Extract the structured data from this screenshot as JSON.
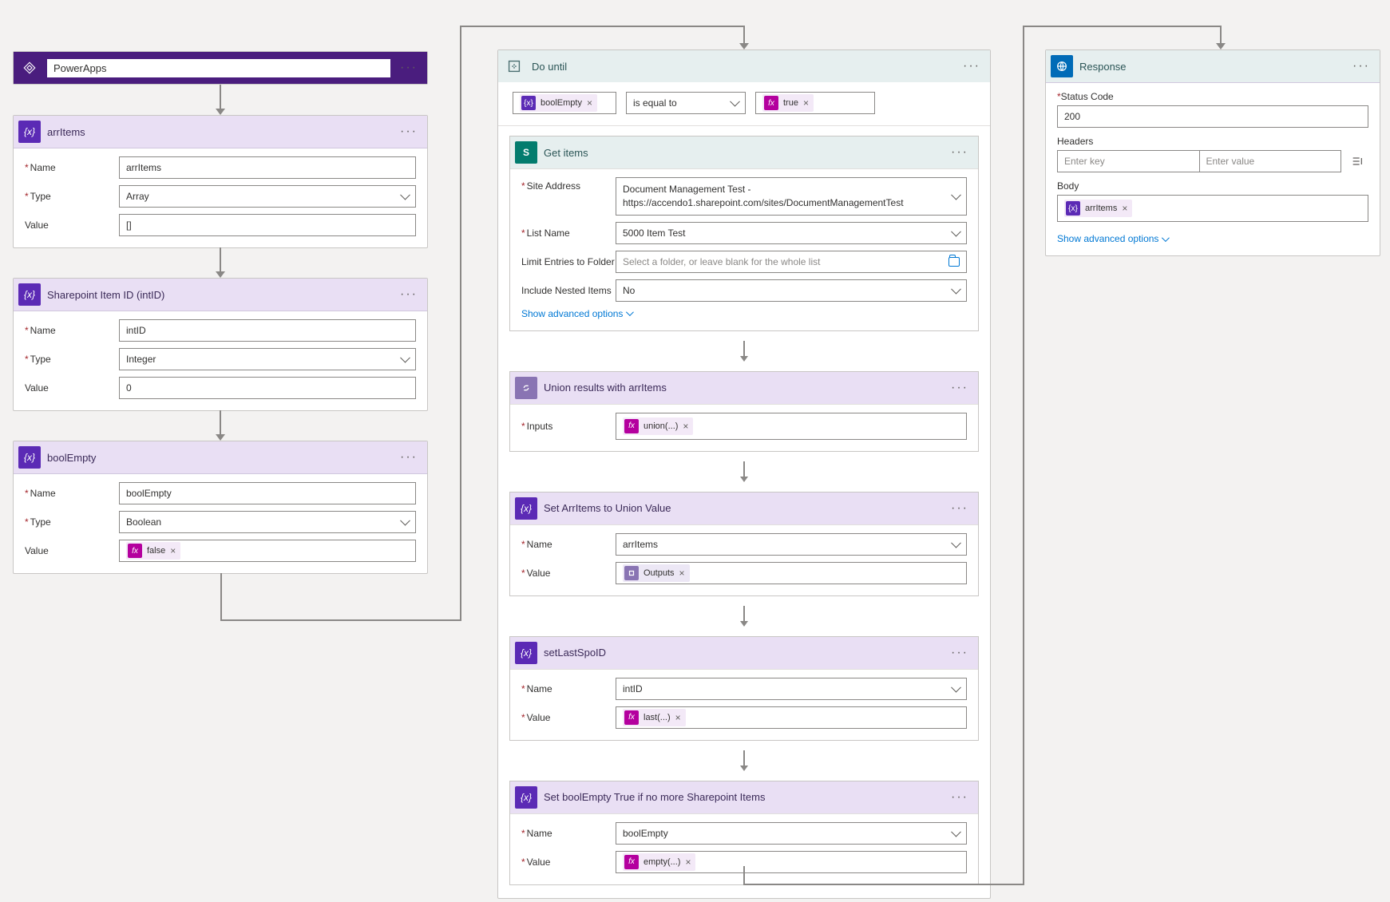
{
  "col1": {
    "powerapps": {
      "title": "PowerApps"
    },
    "arrItems": {
      "title": "arrItems",
      "nameLabel": "Name",
      "nameValue": "arrItems",
      "typeLabel": "Type",
      "typeValue": "Array",
      "valueLabel": "Value",
      "valueValue": "[]"
    },
    "intID": {
      "title": "Sharepoint Item ID (intID)",
      "nameLabel": "Name",
      "nameValue": "intID",
      "typeLabel": "Type",
      "typeValue": "Integer",
      "valueLabel": "Value",
      "valueValue": "0"
    },
    "boolEmpty": {
      "title": "boolEmpty",
      "nameLabel": "Name",
      "nameValue": "boolEmpty",
      "typeLabel": "Type",
      "typeValue": "Boolean",
      "valueLabel": "Value",
      "valueFx": "false"
    }
  },
  "doUntil": {
    "title": "Do until",
    "cond": {
      "leftVar": "boolEmpty",
      "op": "is equal to",
      "rightFx": "true"
    },
    "getItems": {
      "title": "Get items",
      "siteLabel": "Site Address",
      "siteValue": "Document Management Test - https://accendo1.sharepoint.com/sites/DocumentManagementTest",
      "listLabel": "List Name",
      "listValue": "5000 Item Test",
      "limitLabel": "Limit Entries to Folder",
      "limitPlaceholder": "Select a folder, or leave blank for the whole list",
      "nestedLabel": "Include Nested Items",
      "nestedValue": "No",
      "advanced": "Show advanced options"
    },
    "union": {
      "title": "Union results with arrItems",
      "inputsLabel": "Inputs",
      "fx": "union(...)"
    },
    "setArr": {
      "title": "Set ArrItems to Union Value",
      "nameLabel": "Name",
      "nameValue": "arrItems",
      "valueLabel": "Value",
      "valueOut": "Outputs"
    },
    "setLast": {
      "title": "setLastSpoID",
      "nameLabel": "Name",
      "nameValue": "intID",
      "valueLabel": "Value",
      "valueFx": "last(...)"
    },
    "setBool": {
      "title": "Set boolEmpty True if no more Sharepoint Items",
      "nameLabel": "Name",
      "nameValue": "boolEmpty",
      "valueLabel": "Value",
      "valueFx": "empty(...)"
    }
  },
  "response": {
    "title": "Response",
    "statusLabel": "Status Code",
    "statusValue": "200",
    "headersLabel": "Headers",
    "headersKeyPlaceholder": "Enter key",
    "headersValPlaceholder": "Enter value",
    "bodyLabel": "Body",
    "bodyVar": "arrItems",
    "advanced": "Show advanced options"
  }
}
